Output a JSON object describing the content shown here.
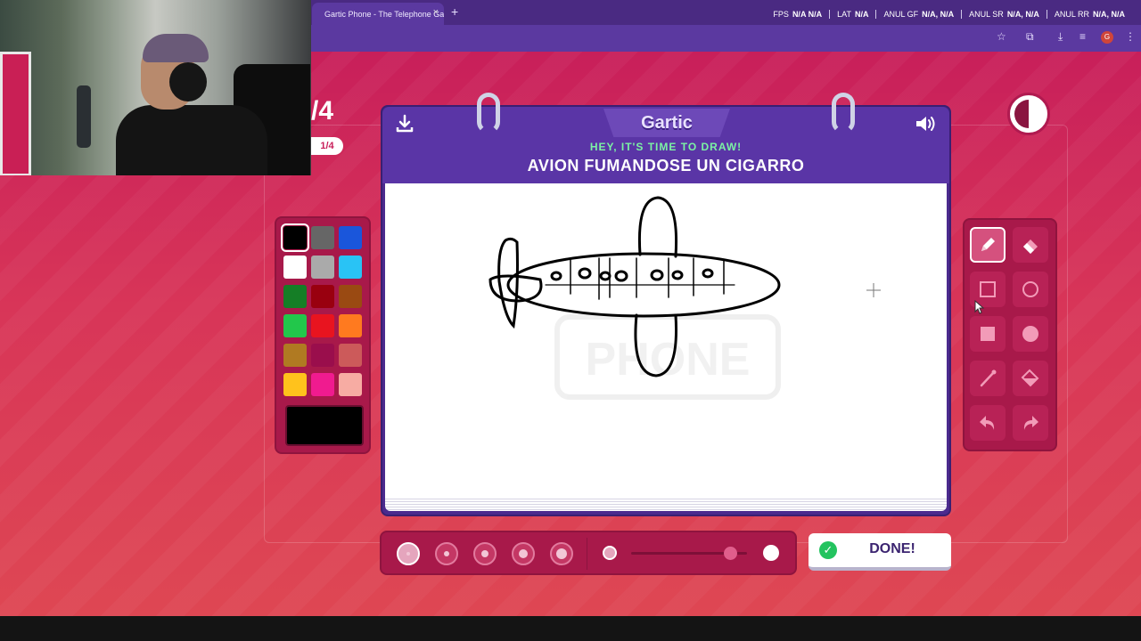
{
  "browser": {
    "tab_title": "Gartic Phone - The Telephone Game",
    "tab_close": "×",
    "new_tab": "+",
    "stats": [
      {
        "label": "FPS",
        "value": "N/A N/A"
      },
      {
        "label": "LAT",
        "value": "N/A"
      },
      {
        "label": "ANUL GF",
        "value": "N/A, N/A"
      },
      {
        "label": "ANUL SR",
        "value": "N/A, N/A"
      },
      {
        "label": "ANUL RR",
        "value": "N/A, N/A"
      }
    ],
    "profile_initial": "G"
  },
  "round": {
    "big": "/4",
    "small": "1/4"
  },
  "header": {
    "logo": "Gartic",
    "subtitle": "HEY, IT'S TIME TO DRAW!",
    "prompt": "AVION FUMANDOSE UN CIGARRO"
  },
  "palette": {
    "colors": [
      "#000000",
      "#666666",
      "#1a56db",
      "#ffffff",
      "#aaaaaa",
      "#29c3f5",
      "#157e26",
      "#99000f",
      "#9a4a12",
      "#22c74b",
      "#e8141f",
      "#ff7a1f",
      "#b07a22",
      "#9a0e4c",
      "#cc5a5a",
      "#ffc21c",
      "#f01b8f",
      "#f7aca3"
    ],
    "selected_index": 0,
    "current_color": "#000000"
  },
  "tools": [
    {
      "name": "pencil-tool",
      "icon": "pencil-icon",
      "active": true
    },
    {
      "name": "eraser-tool",
      "icon": "eraser-icon",
      "active": false
    },
    {
      "name": "rectangle-outline-tool",
      "icon": "rectangle-outline-icon",
      "active": false
    },
    {
      "name": "ellipse-outline-tool",
      "icon": "ellipse-outline-icon",
      "active": false
    },
    {
      "name": "rectangle-fill-tool",
      "icon": "rectangle-fill-icon",
      "active": false
    },
    {
      "name": "ellipse-fill-tool",
      "icon": "ellipse-fill-icon",
      "active": false
    },
    {
      "name": "line-tool",
      "icon": "line-icon",
      "active": false
    },
    {
      "name": "fill-bucket-tool",
      "icon": "fill-bucket-icon",
      "active": false
    },
    {
      "name": "undo-tool",
      "icon": "undo-icon",
      "active": false
    },
    {
      "name": "redo-tool",
      "icon": "redo-icon",
      "active": false
    }
  ],
  "brush": {
    "sizes": [
      1,
      2,
      3,
      4,
      5
    ],
    "selected_size_index": 0,
    "opacity": 0.85
  },
  "actions": {
    "done": "DONE!"
  },
  "canvas": {
    "watermark": "PHONE"
  }
}
